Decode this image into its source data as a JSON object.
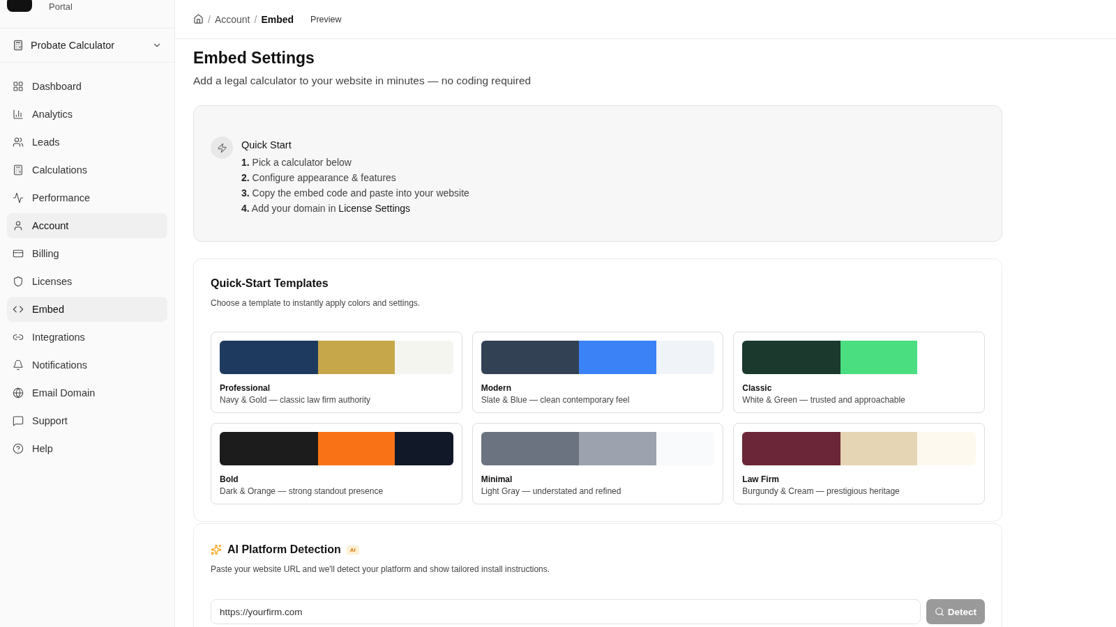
{
  "brand": {
    "name": "Portal"
  },
  "calculator_select": {
    "value": "Probate Calculator"
  },
  "sidebar": {
    "items": [
      {
        "label": "Dashboard",
        "selected": false
      },
      {
        "label": "Analytics",
        "selected": false
      },
      {
        "label": "Leads",
        "selected": false
      },
      {
        "label": "Calculations",
        "selected": false
      },
      {
        "label": "Performance",
        "selected": false
      },
      {
        "label": "Account",
        "selected": true
      },
      {
        "label": "Billing",
        "selected": false
      },
      {
        "label": "Licenses",
        "selected": false
      },
      {
        "label": "Embed",
        "selected": true
      },
      {
        "label": "Integrations",
        "selected": false
      },
      {
        "label": "Notifications",
        "selected": false
      },
      {
        "label": "Email Domain",
        "selected": false
      },
      {
        "label": "Support",
        "selected": false
      },
      {
        "label": "Help",
        "selected": false
      }
    ]
  },
  "breadcrumb": {
    "items": [
      "Account",
      "Embed"
    ],
    "separators": [
      "/",
      "/"
    ],
    "action": "Preview"
  },
  "page": {
    "title": "Embed Settings",
    "subtitle": "Add a legal calculator to your website in minutes — no coding required"
  },
  "quick_start": {
    "title": "Quick Start",
    "steps": [
      {
        "number": "1.",
        "text": "Pick a calculator below"
      },
      {
        "number": "2.",
        "text": "Configure appearance & features"
      },
      {
        "number": "3.",
        "text": "Copy the embed code and paste into your website"
      },
      {
        "number": "4.",
        "text": "Add your domain in ",
        "link": "License Settings"
      }
    ]
  },
  "templates": {
    "title": "Quick-Start Templates",
    "subtitle": "Choose a template to instantly apply colors and settings.",
    "items": [
      {
        "name": "Professional",
        "description": "Navy & Gold — classic law firm authority"
      },
      {
        "name": "Modern",
        "description": "Slate & Blue — clean contemporary feel"
      },
      {
        "name": "Classic",
        "description": "White & Green — trusted and approachable"
      },
      {
        "name": "Bold",
        "description": "Dark & Orange — strong standout presence"
      },
      {
        "name": "Minimal",
        "description": "Light Gray — understated and refined"
      },
      {
        "name": "Law Firm",
        "description": "Burgundy & Cream — prestigious heritage"
      }
    ]
  },
  "ai_detection": {
    "title": "AI Platform Detection",
    "badge": "AI",
    "subtitle": "Paste your website URL and we'll detect your platform and show tailored install instructions.",
    "url": "https://yourfirm.com",
    "button": "Detect",
    "button_disabled": true
  }
}
